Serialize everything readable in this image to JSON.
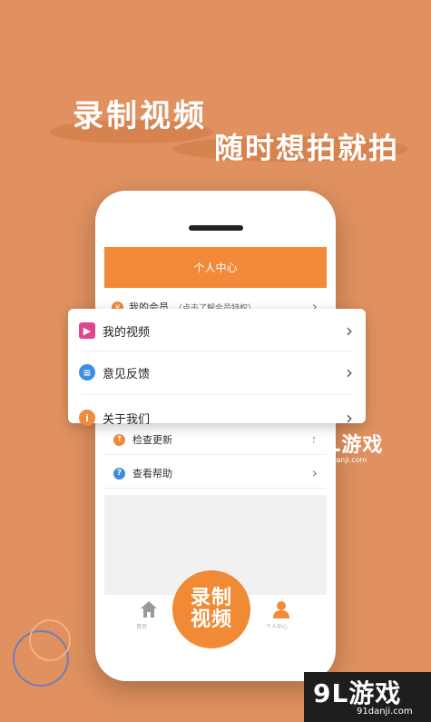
{
  "headline": {
    "line1": "录制视频",
    "line2": "随时想拍就拍"
  },
  "app": {
    "header_title": "个人中心",
    "member_label": "我的会员",
    "member_sub": "（点击了解会员特权）",
    "rows": [
      {
        "label": "检查更新",
        "icon": "up-arrow-icon",
        "color": "#f28a3a"
      },
      {
        "label": "查看帮助",
        "icon": "question-icon",
        "color": "#3b8fe0"
      }
    ],
    "record_button": {
      "line1": "录制",
      "line2": "视频"
    },
    "nav": {
      "home_label": "首页",
      "user_label": "个人中心"
    }
  },
  "card": {
    "items": [
      {
        "label": "我的视频",
        "icon": "video-clapper-icon",
        "color": "#e0458f"
      },
      {
        "label": "意见反馈",
        "icon": "chat-bubble-icon",
        "color": "#3b8fe0"
      },
      {
        "label": "关于我们",
        "icon": "info-icon",
        "color": "#f28a3a"
      }
    ]
  },
  "watermark": {
    "brand": "9L游戏",
    "url": "91danji.com"
  },
  "colors": {
    "background": "#e0915f",
    "accent": "#f28a3a"
  }
}
